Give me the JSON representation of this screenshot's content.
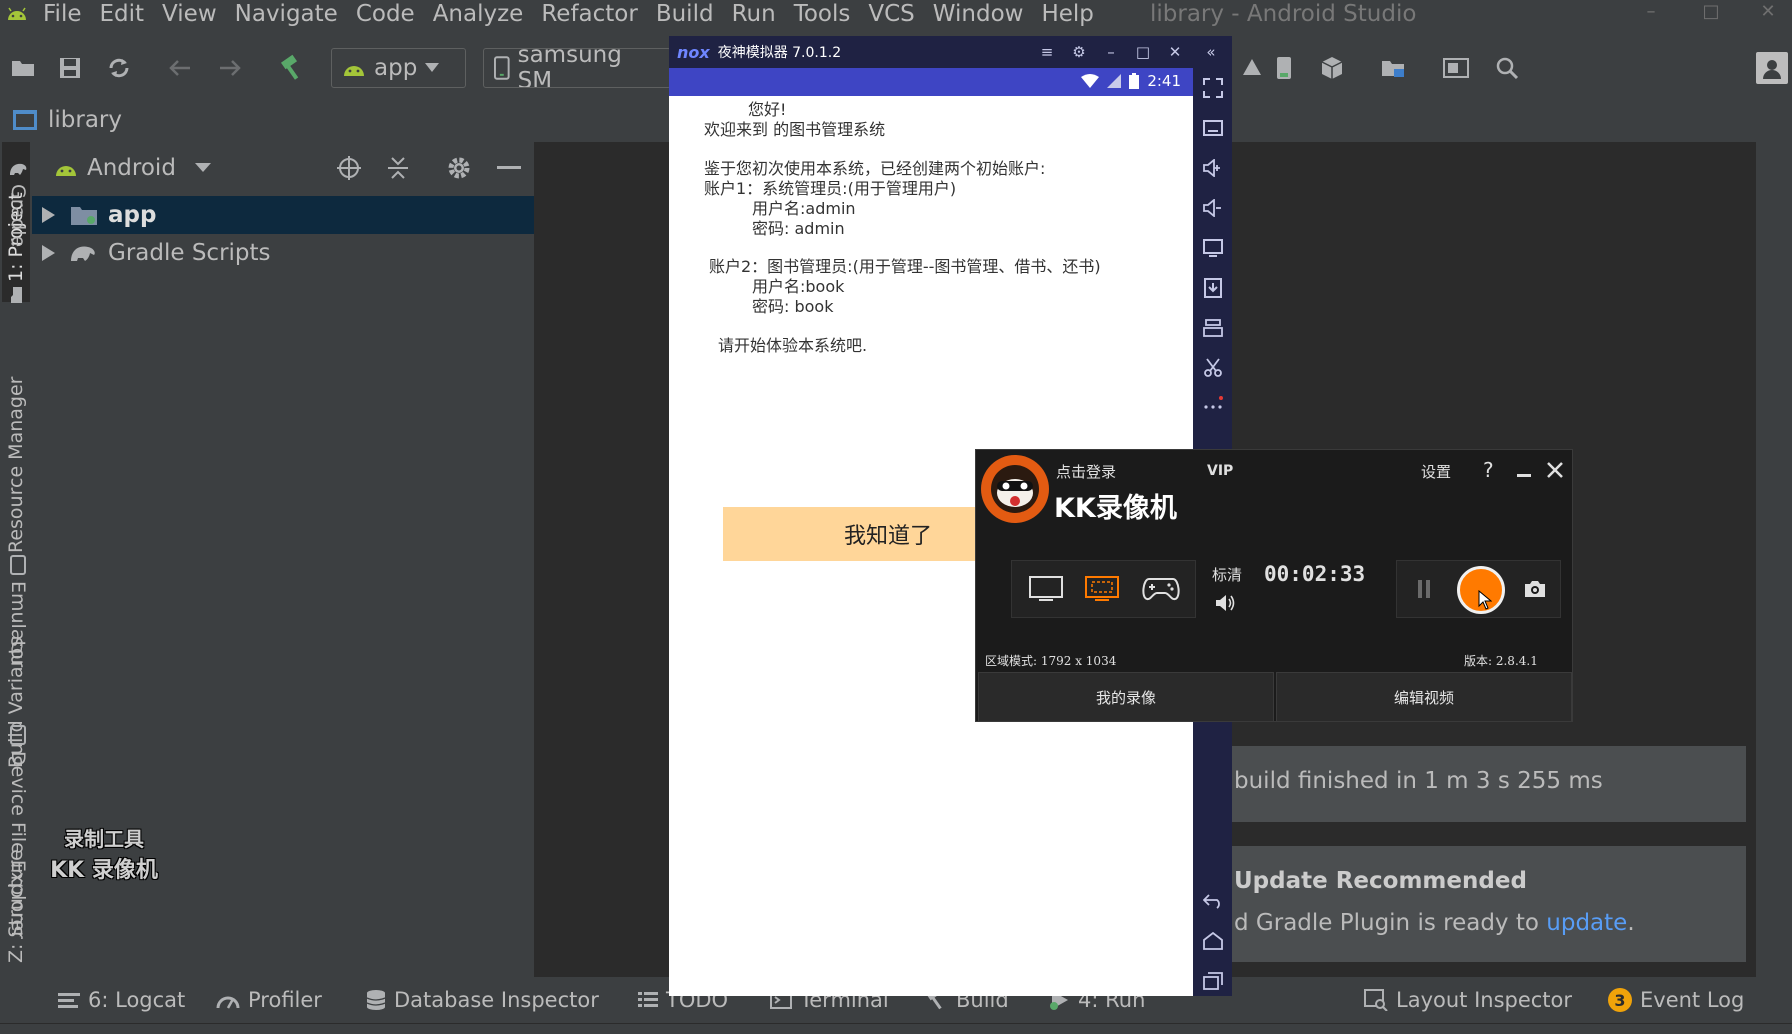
{
  "menu": {
    "items": [
      "File",
      "Edit",
      "View",
      "Navigate",
      "Code",
      "Analyze",
      "Refactor",
      "Build",
      "Run",
      "Tools",
      "VCS",
      "Window",
      "Help"
    ],
    "window_title": "library - Android Studio"
  },
  "toolbar": {
    "config_label": "app",
    "device_label": "samsung SM"
  },
  "breadcrumb": {
    "project": "library"
  },
  "left_tabs": {
    "project": "1: Project",
    "resource_manager": "Resource Manager",
    "build_variants": "Build Variants",
    "structure": "Z: Structure"
  },
  "project_panel": {
    "view_label": "Android",
    "tree": [
      {
        "label": "app"
      },
      {
        "label": "Gradle Scripts"
      }
    ]
  },
  "right_tabs": {
    "gradle": "Gradle",
    "emulator": "Emulator",
    "device_file_explorer": "Device File Explorer"
  },
  "notifications": {
    "build": "build finished in 1 m 3 s 255 ms",
    "update_title": "Update Recommended",
    "update_body": "d Gradle Plugin is ready to",
    "update_link": "update",
    "update_end": "."
  },
  "bottom_tabs": {
    "logcat": "6: Logcat",
    "profiler": "Profiler",
    "database_inspector": "Database Inspector",
    "todo": "TODO",
    "terminal": "Terminal",
    "build": "Build",
    "run": "4: Run",
    "layout_inspector": "Layout Inspector",
    "event_log": "Event Log",
    "event_count": "3"
  },
  "emulator": {
    "logo": "nox",
    "title": "夜神模拟器 7.0.1.2",
    "time": "2:41",
    "lines": {
      "hello": "您好!",
      "welcome": "欢迎来到 的图书管理系统",
      "intro": "鉴于您初次使用本系统，已经创建两个初始账户:",
      "account1": "账户1：系统管理员:(用于管理用户)",
      "account1_user": "用户名:admin",
      "account1_pwd": "密码:   admin",
      "account2": "账户2：图书管理员:(用于管理--图书管理、借书、还书)",
      "account2_user": "用户名:book",
      "account2_pwd": "密码:     book",
      "start": "请开始体验本系统吧."
    },
    "button": "我知道了"
  },
  "kk_recorder": {
    "login": "点击登录",
    "vip": "VIP",
    "settings": "设置",
    "help": "?",
    "brand": "KK录像机",
    "quality": "标清",
    "timer": "00:02:33",
    "region_mode": "区域模式: 1792 x 1034",
    "version": "版本: 2.8.4.1",
    "my_recordings": "我的录像",
    "edit_video": "编辑视频"
  },
  "watermark": {
    "line1": "录制工具",
    "line2": "KK 录像机"
  },
  "colors": {
    "ide_bg": "#3c3f41",
    "editor_bg": "#2b2b2b",
    "selection": "#0d293e",
    "android_green": "#a4c639",
    "link": "#589df6",
    "nox_dark": "#1f2243",
    "nox_status": "#3e45c4",
    "button_orange": "#ffd699",
    "record_orange": "#ff7a00"
  }
}
